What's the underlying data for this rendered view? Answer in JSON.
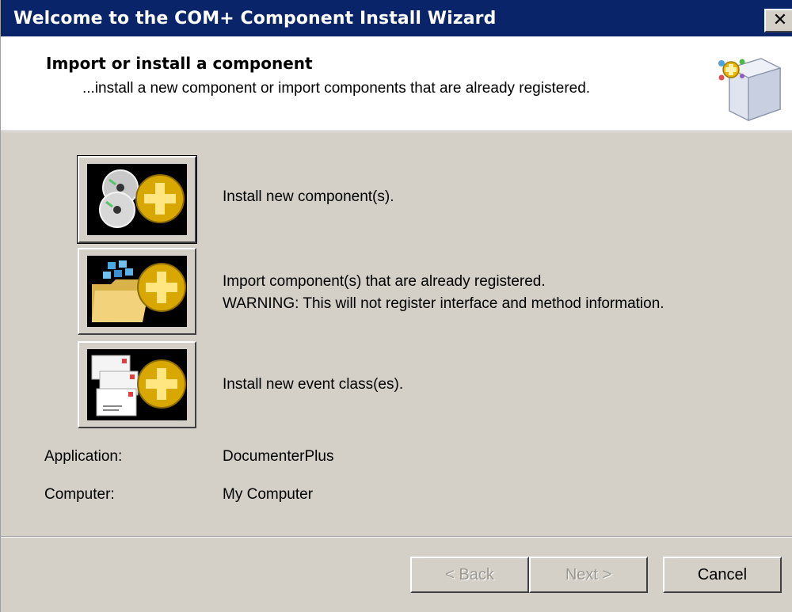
{
  "window": {
    "title": "Welcome to the COM+ Component Install Wizard",
    "close_label": "✕"
  },
  "header": {
    "title": "Import or install a component",
    "subtitle": "...install a new component or import components that are already registered.",
    "icon": "package-add-icon"
  },
  "options": [
    {
      "label": "Install new component(s).",
      "icon": "cd-add-icon"
    },
    {
      "label_line1": "Import component(s) that are already registered.",
      "label_line2": "WARNING: This will not register interface and method information.",
      "icon": "folder-add-icon"
    },
    {
      "label": "Install new event class(es).",
      "icon": "mail-add-icon"
    }
  ],
  "info": {
    "application_label": "Application:",
    "application_value": "DocumenterPlus",
    "computer_label": "Computer:",
    "computer_value": "My Computer"
  },
  "buttons": {
    "back": "< Back",
    "next": "Next >",
    "cancel": "Cancel"
  },
  "colors": {
    "titlebar": "#0a246a",
    "face": "#d4d0c8",
    "accent_gold": "#e8b400"
  }
}
